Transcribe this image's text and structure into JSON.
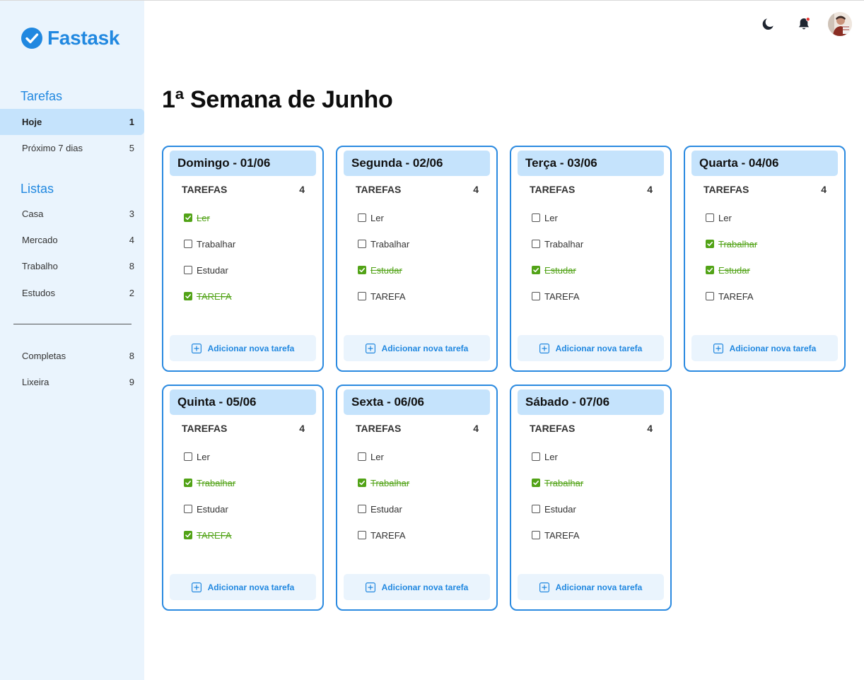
{
  "app": {
    "name": "Fastask"
  },
  "colors": {
    "accent": "#2188e0",
    "done": "#52a317",
    "card_header": "#c5e3fc",
    "sidebar_bg": "#eaf4fd"
  },
  "sidebar": {
    "tasks_title": "Tarefas",
    "tasks_items": [
      {
        "label": "Hoje",
        "count": "1",
        "active": true
      },
      {
        "label": "Próximo 7 dias",
        "count": "5",
        "active": false
      }
    ],
    "lists_title": "Listas",
    "lists_items": [
      {
        "label": "Casa",
        "count": "3"
      },
      {
        "label": "Mercado",
        "count": "4"
      },
      {
        "label": "Trabalho",
        "count": "8"
      },
      {
        "label": "Estudos",
        "count": "2"
      }
    ],
    "bottom_items": [
      {
        "label": "Completas",
        "count": "8"
      },
      {
        "label": "Lixeira",
        "count": "9"
      }
    ]
  },
  "header": {
    "icons": [
      "moon-icon",
      "bell-icon",
      "avatar"
    ]
  },
  "page": {
    "title": "1ª Semana de Junho"
  },
  "days": [
    {
      "title": "Domingo - 01/06",
      "sub_label": "TAREFAS",
      "count": "4",
      "add_label": "Adicionar nova tarefa",
      "tasks": [
        {
          "label": "Ler",
          "done": true
        },
        {
          "label": "Trabalhar",
          "done": false
        },
        {
          "label": "Estudar",
          "done": false
        },
        {
          "label": "TAREFA",
          "done": true
        }
      ]
    },
    {
      "title": "Segunda - 02/06",
      "sub_label": "TAREFAS",
      "count": "4",
      "add_label": "Adicionar nova tarefa",
      "tasks": [
        {
          "label": "Ler",
          "done": false
        },
        {
          "label": "Trabalhar",
          "done": false
        },
        {
          "label": "Estudar",
          "done": true
        },
        {
          "label": "TAREFA",
          "done": false
        }
      ]
    },
    {
      "title": "Terça - 03/06",
      "sub_label": "TAREFAS",
      "count": "4",
      "add_label": "Adicionar nova tarefa",
      "tasks": [
        {
          "label": "Ler",
          "done": false
        },
        {
          "label": "Trabalhar",
          "done": false
        },
        {
          "label": "Estudar",
          "done": true
        },
        {
          "label": "TAREFA",
          "done": false
        }
      ]
    },
    {
      "title": "Quarta - 04/06",
      "sub_label": "TAREFAS",
      "count": "4",
      "add_label": "Adicionar nova tarefa",
      "tasks": [
        {
          "label": "Ler",
          "done": false
        },
        {
          "label": "Trabalhar",
          "done": true
        },
        {
          "label": "Estudar",
          "done": true
        },
        {
          "label": "TAREFA",
          "done": false
        }
      ]
    },
    {
      "title": "Quinta - 05/06",
      "sub_label": "TAREFAS",
      "count": "4",
      "add_label": "Adicionar nova tarefa",
      "tasks": [
        {
          "label": "Ler",
          "done": false
        },
        {
          "label": "Trabalhar",
          "done": true
        },
        {
          "label": "Estudar",
          "done": false
        },
        {
          "label": "TAREFA",
          "done": true
        }
      ]
    },
    {
      "title": "Sexta - 06/06",
      "sub_label": "TAREFAS",
      "count": "4",
      "add_label": "Adicionar nova tarefa",
      "tasks": [
        {
          "label": "Ler",
          "done": false
        },
        {
          "label": "Trabalhar",
          "done": true
        },
        {
          "label": "Estudar",
          "done": false
        },
        {
          "label": "TAREFA",
          "done": false
        }
      ]
    },
    {
      "title": "Sábado - 07/06",
      "sub_label": "TAREFAS",
      "count": "4",
      "add_label": "Adicionar nova tarefa",
      "tasks": [
        {
          "label": "Ler",
          "done": false
        },
        {
          "label": "Trabalhar",
          "done": true
        },
        {
          "label": "Estudar",
          "done": false
        },
        {
          "label": "TAREFA",
          "done": false
        }
      ]
    }
  ]
}
